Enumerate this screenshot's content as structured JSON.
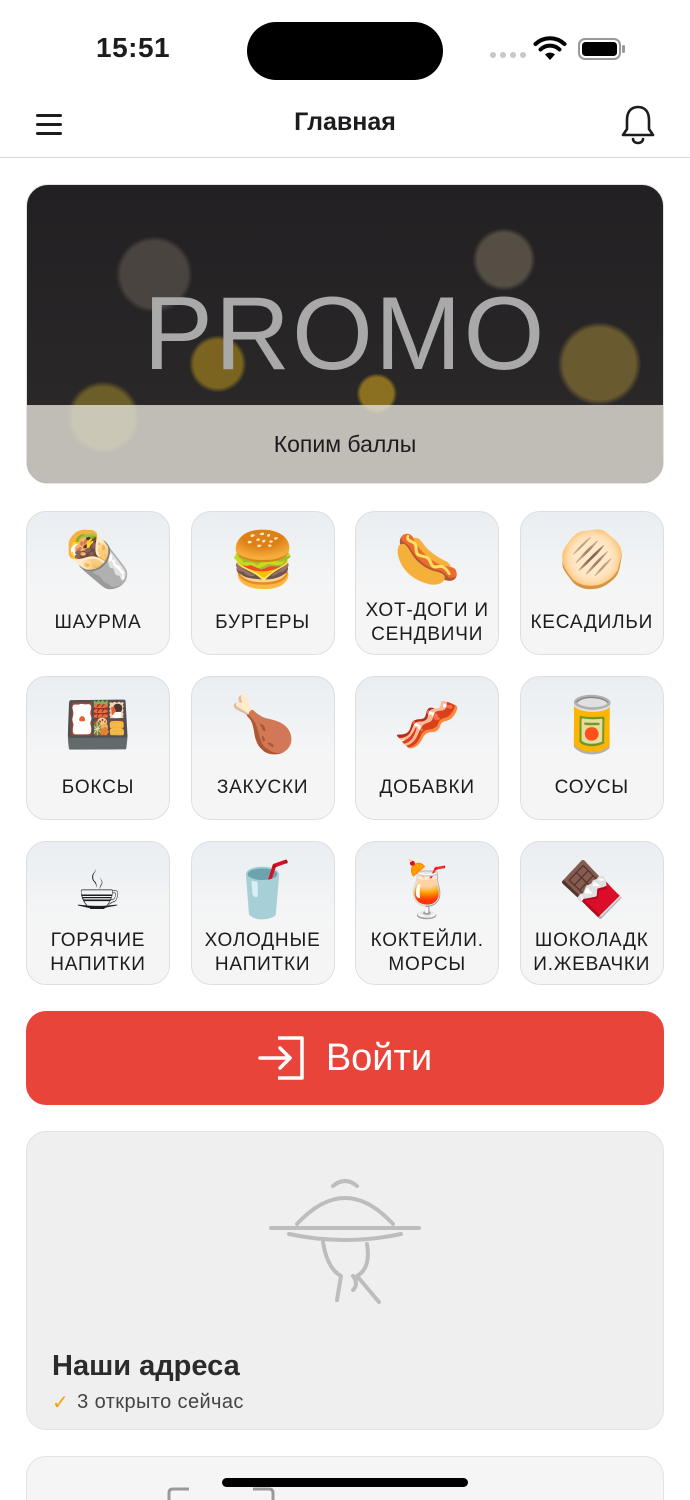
{
  "status_bar": {
    "time": "15:51",
    "icons": [
      "signal-icon",
      "wifi-icon",
      "battery-icon"
    ]
  },
  "navbar": {
    "title": "Главная",
    "left_icon": "menu-icon",
    "right_icon": "bell-icon"
  },
  "promo": {
    "headline": "PROMO",
    "caption": "Копим баллы"
  },
  "categories": [
    {
      "label": "ШАУРМА",
      "icon": "🌯"
    },
    {
      "label": "БУРГЕРЫ",
      "icon": "🍔"
    },
    {
      "label": "ХОТ-ДОГИ И\nСЕНДВИЧИ",
      "icon": "🌭"
    },
    {
      "label": "КЕСАДИЛЬИ",
      "icon": "🫓"
    },
    {
      "label": "БОКСЫ",
      "icon": "🍱"
    },
    {
      "label": "ЗАКУСКИ",
      "icon": "🍗"
    },
    {
      "label": "ДОБАВКИ",
      "icon": "🥓"
    },
    {
      "label": "СОУСЫ",
      "icon": "🥫"
    },
    {
      "label": "ГОРЯЧИЕ\nНАПИТКИ",
      "icon": "☕"
    },
    {
      "label": "ХОЛОДНЫЕ\nНАПИТКИ",
      "icon": "🥤"
    },
    {
      "label": "КОКТЕЙЛИ.\nМОРСЫ",
      "icon": "🍹"
    },
    {
      "label": "ШОКОЛАДК\nИ.ЖЕВАЧКИ",
      "icon": "🍫"
    }
  ],
  "login": {
    "label": "Войти",
    "icon": "login-icon"
  },
  "addresses": {
    "title": "Наши адреса",
    "status": "3 открыто сейчас",
    "icon": "cloche-icon"
  },
  "colors": {
    "accent": "#e8443a",
    "check": "#f0a500"
  }
}
